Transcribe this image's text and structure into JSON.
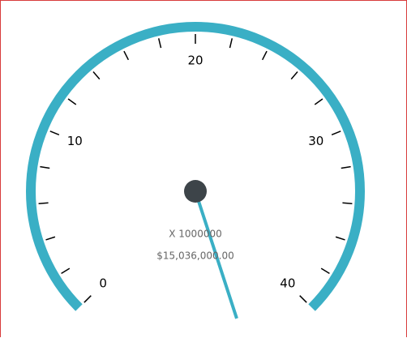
{
  "gauge": {
    "min": 0,
    "max": 40,
    "value": 44,
    "major_step": 10,
    "minor_step": 2,
    "scale_text": "X 1000000",
    "value_text": "$15,036,000.00",
    "colors": {
      "arc": "#3aafc5",
      "needle": "#3aafc5",
      "cap": "#3d4449",
      "tick": "#000000"
    },
    "labels": [
      "0",
      "10",
      "20",
      "30",
      "40"
    ]
  }
}
